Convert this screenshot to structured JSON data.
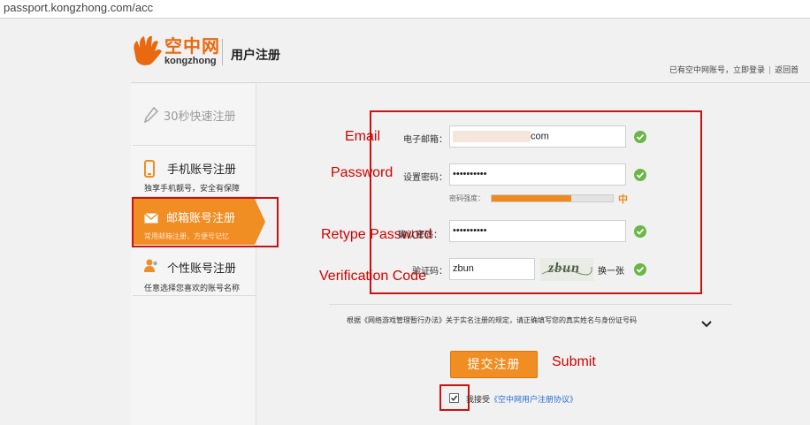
{
  "browser": {
    "url": "passport.kongzhong.com/acc"
  },
  "header": {
    "logo_cn": "空中网",
    "logo_en": "kongzhong",
    "title": "用户注册",
    "have_account": "已有空中网账号，立即登录",
    "back_link": "返回首"
  },
  "sidebar": {
    "quick": "30秒快速注册",
    "items": [
      {
        "title": "手机账号注册",
        "sub": "独享手机靓号，安全有保障"
      },
      {
        "title": "邮箱账号注册",
        "sub": "常用邮箱注册，方便号记忆"
      },
      {
        "title": "个性账号注册",
        "sub": "任意选择您喜欢的账号名称"
      }
    ]
  },
  "form": {
    "email_label": "电子邮箱：",
    "email_value": "com",
    "password_label": "设置密码：",
    "password_value": "••••••••••",
    "strength_label": "密码强度：",
    "strength_level": 0.66,
    "strength_text": "中",
    "confirm_label": "确认密码：",
    "confirm_value": "••••••••••",
    "code_label": "验证码：",
    "code_value": "zbun",
    "captcha_text": "zbun",
    "refresh_label": "换一张"
  },
  "annotations": {
    "email": "Email",
    "password": "Password",
    "retype": "Retype Password",
    "verification": "Verification Code",
    "submit": "Submit"
  },
  "notice": "根据《网络游戏管理暂行办法》关于实名注册的规定，请正确填写您的真实姓名与身份证号码",
  "submit_label": "提交注册",
  "agree": {
    "text": "我接受",
    "link": "《空中网用户注册协议》",
    "checked": true
  },
  "colors": {
    "accent": "#f08d23",
    "success": "#6cb648",
    "annotation": "#cc1111",
    "link": "#2a6fcf"
  },
  "icons": [
    "hand-logo-icon",
    "pencil-icon",
    "phone-icon",
    "envelope-icon",
    "person-icon",
    "check-icon",
    "chevron-down-icon"
  ]
}
